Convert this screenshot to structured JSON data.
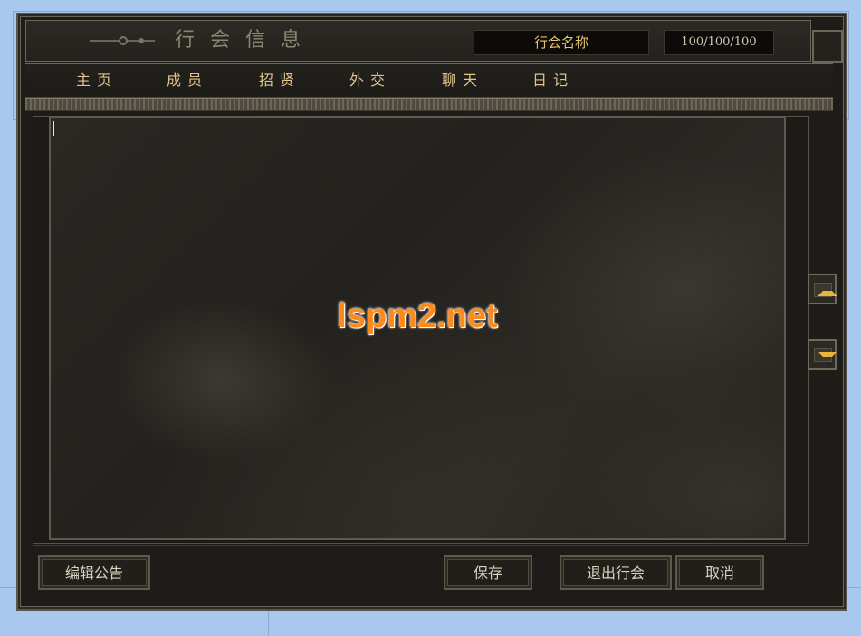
{
  "window": {
    "title": "行会信息",
    "guild_name": "行会名称",
    "guild_stats": "100/100/100"
  },
  "tabs": [
    {
      "label": "主页"
    },
    {
      "label": "成员"
    },
    {
      "label": "招贤"
    },
    {
      "label": "外交"
    },
    {
      "label": "聊天"
    },
    {
      "label": "日记"
    }
  ],
  "content": {
    "watermark": "lspm2.net"
  },
  "buttons": {
    "edit_notice": "编辑公告",
    "save": "保存",
    "leave_guild": "退出行会",
    "cancel": "取消"
  },
  "colors": {
    "accent_gold": "#e6c766",
    "tab_text": "#e0c48c",
    "watermark": "#ff8a1a"
  },
  "icons": {
    "scroll_up": "up-arrow-icon",
    "scroll_down": "down-arrow-icon"
  }
}
